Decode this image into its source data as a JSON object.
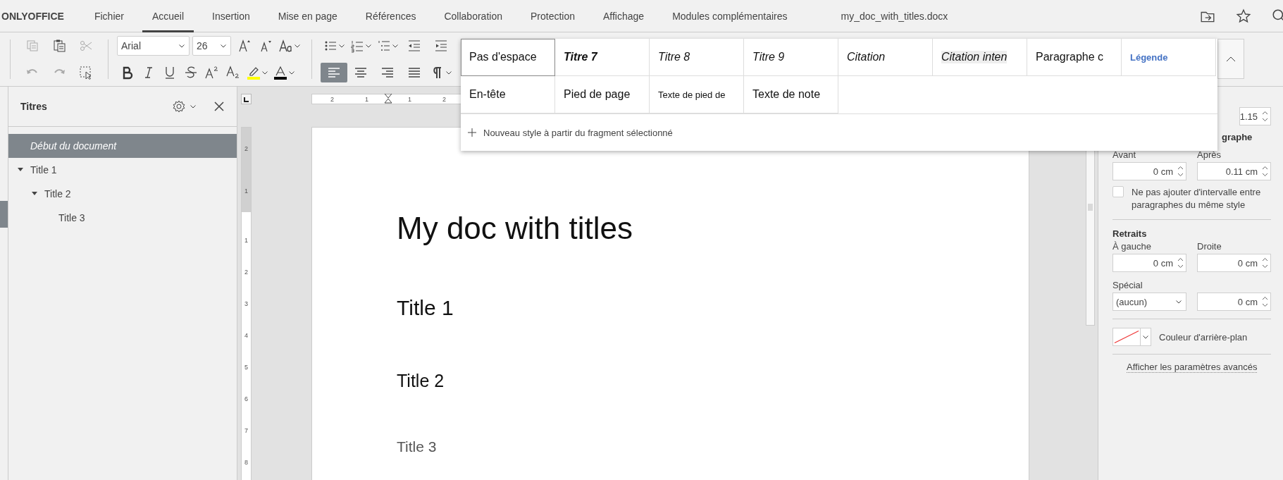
{
  "app": {
    "logo": "ONLYOFFICE",
    "file_name": "my_doc_with_titles.docx"
  },
  "menu_tabs": [
    {
      "label": "Fichier",
      "selected": false
    },
    {
      "label": "Accueil",
      "selected": true
    },
    {
      "label": "Insertion",
      "selected": false
    },
    {
      "label": "Mise en page",
      "selected": false
    },
    {
      "label": "Références",
      "selected": false
    },
    {
      "label": "Collaboration",
      "selected": false
    },
    {
      "label": "Protection",
      "selected": false
    },
    {
      "label": "Affichage",
      "selected": false
    },
    {
      "label": "Modules complémentaires",
      "selected": false
    }
  ],
  "toolbar": {
    "font_name": "Arial",
    "font_size": "26",
    "alignment_buttons": [
      {
        "selected": true
      },
      {
        "selected": false
      },
      {
        "selected": false
      },
      {
        "selected": false
      }
    ]
  },
  "navigation": {
    "title": "Titres",
    "items": [
      {
        "label": "Début du document",
        "selected": true
      },
      {
        "label": "Title 1",
        "selected": false,
        "expanded": true,
        "children": [
          {
            "label": "Title 2",
            "selected": false,
            "expanded": true,
            "children": [
              {
                "label": "Title 3",
                "selected": false
              }
            ]
          }
        ]
      }
    ]
  },
  "rulers": {
    "horizontal": [
      "2",
      "1",
      "1",
      "2"
    ],
    "vertical": [
      "2",
      "1",
      "1",
      "2",
      "3",
      "4",
      "5",
      "6",
      "7",
      "8"
    ]
  },
  "document": {
    "paragraphs": [
      {
        "kind": "title",
        "text": "My doc with titles"
      },
      {
        "kind": "heading1",
        "text": "Title 1"
      },
      {
        "kind": "heading2",
        "text": "Title 2"
      },
      {
        "kind": "heading3",
        "text": "Title 3"
      }
    ]
  },
  "styles_gallery": {
    "styles": [
      {
        "label": "Pas d'espace",
        "kind": "normal",
        "selected": true
      },
      {
        "label": "Titre 7",
        "kind": "bold-italic",
        "selected": false
      },
      {
        "label": "Titre 8",
        "kind": "italic",
        "selected": false
      },
      {
        "label": "Titre 9",
        "kind": "italic",
        "selected": false
      },
      {
        "label": "Citation",
        "kind": "italic",
        "selected": false
      },
      {
        "label": "Citation inten",
        "kind": "intense-quote",
        "selected": false
      },
      {
        "label": "Paragraphe c",
        "kind": "normal",
        "selected": false
      },
      {
        "label": "Légende",
        "kind": "caption",
        "selected": false
      },
      {
        "label": "En-tête",
        "kind": "normal",
        "selected": false
      },
      {
        "label": "Pied de page",
        "kind": "normal",
        "selected": false
      },
      {
        "label": "Texte de pied de",
        "kind": "small",
        "selected": false
      },
      {
        "label": "Texte de note",
        "kind": "normal",
        "selected": false
      }
    ],
    "new_style": "Nouveau style à partir du fragment sélectionné"
  },
  "paragraph_settings": {
    "line_spacing_value": "1.15",
    "spacing_heading": "graphe",
    "before_label": "Avant",
    "after_label": "Après",
    "before_value": "0 cm",
    "after_value": "0.11 cm",
    "no_interval": {
      "label": "Ne pas ajouter d'intervalle entre paragraphes du même style",
      "checked": false
    },
    "indents_heading": "Retraits",
    "left_label": "À gauche",
    "right_label": "Droite",
    "left_value": "0 cm",
    "right_value": "0 cm",
    "special_label": "Spécial",
    "special_value": "(aucun)",
    "special_amount": "0 cm",
    "background_color_label": "Couleur d'arrière-plan",
    "advanced_link": "Afficher les paramètres avancés"
  }
}
